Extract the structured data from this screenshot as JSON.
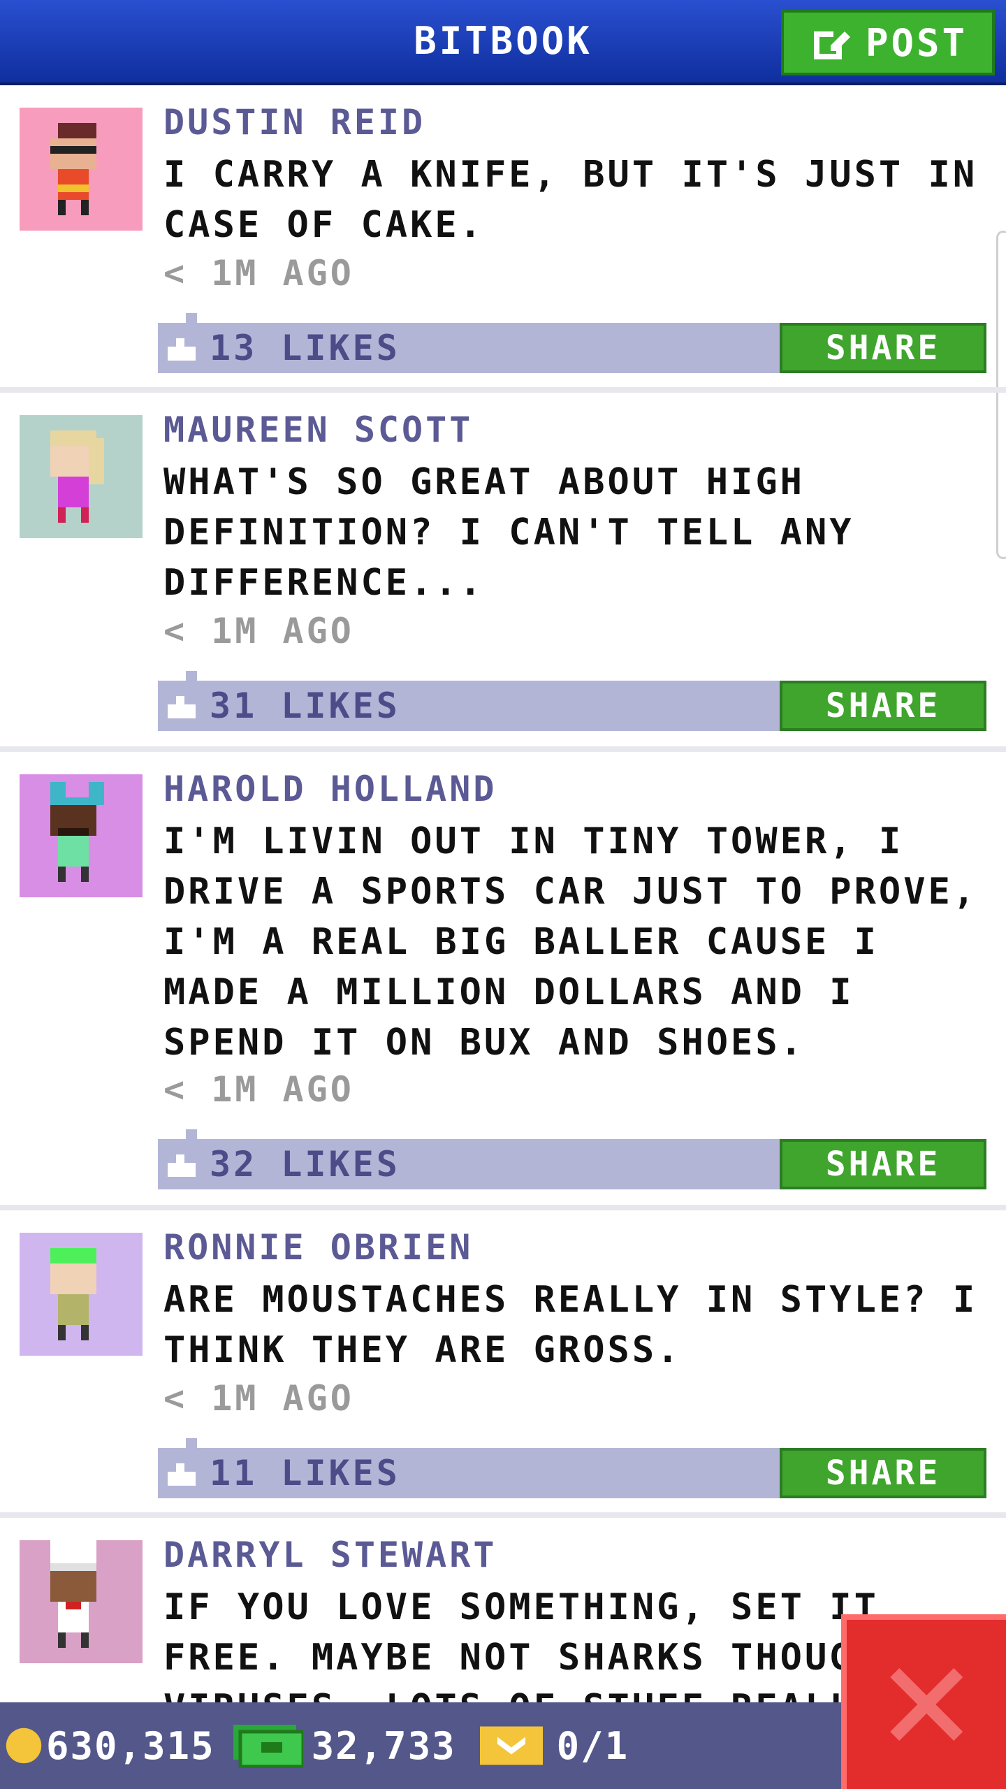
{
  "header": {
    "title": "BITBOOK",
    "post_label": "POST"
  },
  "posts": [
    {
      "name": "DUSTIN REID",
      "message": "I CARRY A KNIFE, BUT IT'S JUST IN CASE OF CAKE.",
      "time": "< 1M AGO",
      "likes": "13 LIKES",
      "share_label": "SHARE",
      "avatar_bg": "#f79cbc"
    },
    {
      "name": "MAUREEN SCOTT",
      "message": "WHAT'S SO GREAT ABOUT HIGH DEFINITION? I CAN'T TELL ANY DIFFERENCE...",
      "time": "< 1M AGO",
      "likes": "31 LIKES",
      "share_label": "SHARE",
      "avatar_bg": "#b4d2c9"
    },
    {
      "name": "HAROLD HOLLAND",
      "message": "I'M LIVIN OUT IN TINY TOWER, I DRIVE A SPORTS CAR JUST TO PROVE, I'M A REAL BIG BALLER CAUSE I MADE A MILLION DOLLARS AND I SPEND IT ON BUX AND SHOES.",
      "time": "< 1M AGO",
      "likes": "32 LIKES",
      "share_label": "SHARE",
      "avatar_bg": "#d88ee4"
    },
    {
      "name": "RONNIE OBRIEN",
      "message": "ARE MOUSTACHES REALLY IN STYLE? I THINK THEY ARE GROSS.",
      "time": "< 1M AGO",
      "likes": "11 LIKES",
      "share_label": "SHARE",
      "avatar_bg": "#d0b6ef"
    },
    {
      "name": "DARRYL STEWART",
      "message": "IF YOU LOVE SOMETHING, SET IT FREE. MAYBE NOT SHARKS THOUGH. OR VIRUSES. LOTS OF STUFF REALLY.",
      "time": "",
      "likes": "",
      "share_label": "",
      "avatar_bg": "#d9a1c6"
    }
  ],
  "footer": {
    "coins": "630,315",
    "bux": "32,733",
    "tickets": "0/1"
  },
  "colors": {
    "header": "#1c3fbf",
    "post_button": "#3db22f",
    "like_bar": "#b3b5d7",
    "share": "#3fa52d",
    "footer": "#54578a",
    "close": "#e32c2c"
  }
}
